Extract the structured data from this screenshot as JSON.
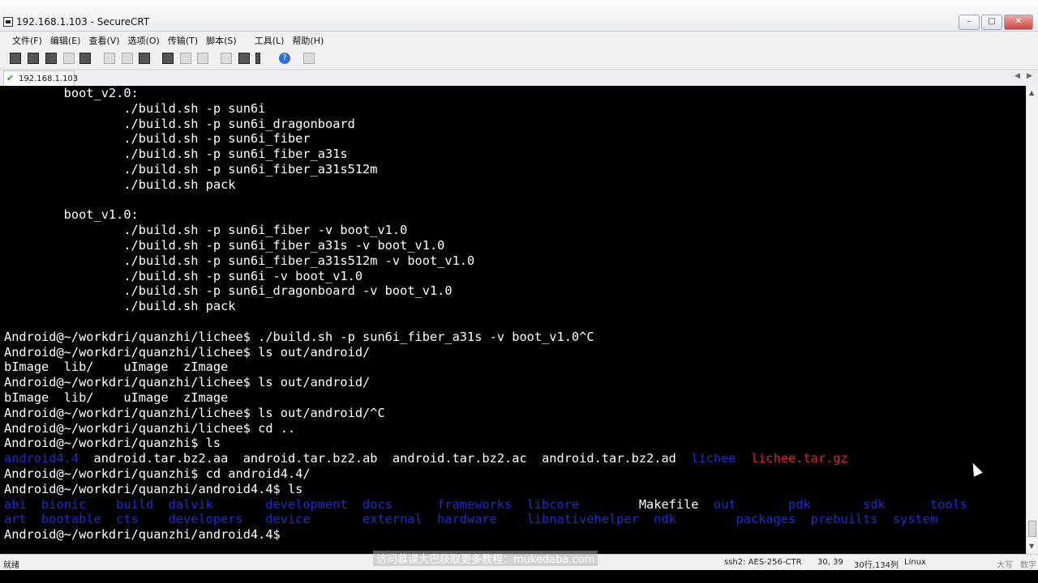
{
  "window": {
    "title": "192.168.1.103 - SecureCRT"
  },
  "menu": [
    "文件(F)",
    "编辑(E)",
    "查看(V)",
    "选项(O)",
    "传输(T)",
    "脚本(S)",
    "工具(L)",
    "帮助(H)"
  ],
  "tab": {
    "label": "192.168.1.103"
  },
  "terminal": {
    "lines": [
      [
        {
          "t": "        boot_v2.0:"
        }
      ],
      [
        {
          "t": "                ./build.sh -p sun6i"
        }
      ],
      [
        {
          "t": "                ./build.sh -p sun6i_dragonboard"
        }
      ],
      [
        {
          "t": "                ./build.sh -p sun6i_fiber"
        }
      ],
      [
        {
          "t": "                ./build.sh -p sun6i_fiber_a31s"
        }
      ],
      [
        {
          "t": "                ./build.sh -p sun6i_fiber_a31s512m"
        }
      ],
      [
        {
          "t": "                ./build.sh pack"
        }
      ],
      [
        {
          "t": ""
        }
      ],
      [
        {
          "t": "        boot_v1.0:"
        }
      ],
      [
        {
          "t": "                ./build.sh -p sun6i_fiber -v boot_v1.0"
        }
      ],
      [
        {
          "t": "                ./build.sh -p sun6i_fiber_a31s -v boot_v1.0"
        }
      ],
      [
        {
          "t": "                ./build.sh -p sun6i_fiber_a31s512m -v boot_v1.0"
        }
      ],
      [
        {
          "t": "                ./build.sh -p sun6i -v boot_v1.0"
        }
      ],
      [
        {
          "t": "                ./build.sh -p sun6i_dragonboard -v boot_v1.0"
        }
      ],
      [
        {
          "t": "                ./build.sh pack"
        }
      ],
      [
        {
          "t": ""
        }
      ],
      [
        {
          "t": "Android@~/workdri/quanzhi/lichee$ ./build.sh -p sun6i_fiber_a31s -v boot_v1.0^C"
        }
      ],
      [
        {
          "t": "Android@~/workdri/quanzhi/lichee$ ls out/android/"
        }
      ],
      [
        {
          "t": "bImage  lib/    uImage  zImage"
        }
      ],
      [
        {
          "t": "Android@~/workdri/quanzhi/lichee$ ls out/android/"
        }
      ],
      [
        {
          "t": "bImage  lib/    uImage  zImage"
        }
      ],
      [
        {
          "t": "Android@~/workdri/quanzhi/lichee$ ls out/android/^C"
        }
      ],
      [
        {
          "t": "Android@~/workdri/quanzhi/lichee$ cd .."
        }
      ],
      [
        {
          "t": "Android@~/workdri/quanzhi$ ls"
        }
      ],
      [
        {
          "t": "android4.4",
          "c": "blue"
        },
        {
          "t": "  android.tar.bz2.aa  android.tar.bz2.ab  android.tar.bz2.ac  android.tar.bz2.ad  "
        },
        {
          "t": "lichee",
          "c": "blue"
        },
        {
          "t": "  "
        },
        {
          "t": "lichee.tar.gz",
          "c": "red"
        }
      ],
      [
        {
          "t": "Android@~/workdri/quanzhi$ cd android4.4/"
        }
      ],
      [
        {
          "t": "Android@~/workdri/quanzhi/android4.4$ ls"
        }
      ],
      [
        {
          "t": "abi  bionic    build  dalvik       development  docs      frameworks  libcore        ",
          "c": "blue"
        },
        {
          "t": "Makefile  "
        },
        {
          "t": "out       pdk       sdk      tools",
          "c": "blue"
        }
      ],
      [
        {
          "t": "art  bootable  cts    developers   device       external  hardware    libnativehelper  ndk        packages  prebuilts  system",
          "c": "blue"
        }
      ],
      [
        {
          "t": "Android@~/workdri/quanzhi/android4.4$ "
        }
      ]
    ]
  },
  "status": {
    "ready": "就绪",
    "cipher": "ssh2: AES-256-CTR",
    "cursor_pos": "30, 39",
    "dims": "30行,134列",
    "os": "Linux",
    "caps": "大写",
    "num": "数字"
  },
  "watermark": "访问慕课大巴获取更多教程：mukedaba.com"
}
